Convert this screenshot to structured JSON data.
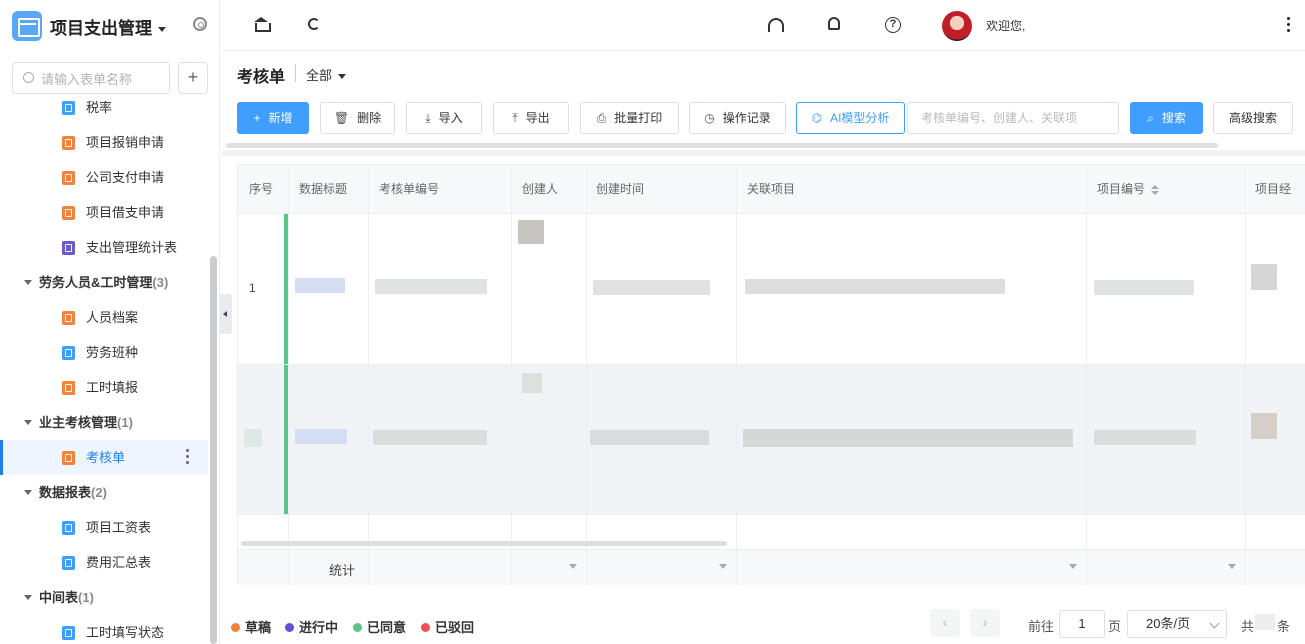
{
  "app": {
    "title": "项目支出管理"
  },
  "sidebar": {
    "search_placeholder": "请输入表单名称",
    "add_label": "+",
    "items": [
      {
        "label": "税率",
        "color": "#409eff"
      },
      {
        "label": "项目报销申请",
        "color": "#f4823c"
      },
      {
        "label": "公司支付申请",
        "color": "#f4823c"
      },
      {
        "label": "项目借支申请",
        "color": "#f4823c"
      },
      {
        "label": "支出管理统计表",
        "color": "#6a5acd"
      }
    ],
    "group_labor": {
      "label": "劳务人员&工时管理",
      "count": "(3)"
    },
    "labor_items": [
      {
        "label": "人员档案",
        "color": "#f4823c"
      },
      {
        "label": "劳务班种",
        "color": "#409eff"
      },
      {
        "label": "工时填报",
        "color": "#f4823c"
      }
    ],
    "group_owner": {
      "label": "业主考核管理",
      "count": "(1)"
    },
    "owner_items": [
      {
        "label": "考核单",
        "color": "#f4823c"
      }
    ],
    "group_report": {
      "label": "数据报表",
      "count": "(2)"
    },
    "report_items": [
      {
        "label": "项目工资表",
        "color": "#409eff"
      },
      {
        "label": "费用汇总表",
        "color": "#409eff"
      }
    ],
    "group_mid": {
      "label": "中间表",
      "count": "(1)"
    },
    "mid_items": [
      {
        "label": "工时填写状态",
        "color": "#409eff"
      }
    ]
  },
  "topbar": {
    "welcome": "欢迎您,",
    "help_glyph": "?"
  },
  "header": {
    "title": "考核单",
    "filter": "全部"
  },
  "toolbar": {
    "add": "新增",
    "add_icon": "+",
    "delete": "删除",
    "delete_icon": "🗑",
    "import": "导入",
    "import_icon": "⤓",
    "export": "导出",
    "export_icon": "⤒",
    "batch_print": "批量打印",
    "print_icon": "⎙",
    "op_log": "操作记录",
    "log_icon": "◷",
    "ai": "AI模型分析",
    "ai_icon": "⌬",
    "search_placeholder": "考核单编号、创建人、关联项",
    "search": "搜索",
    "search_icon": "⌕",
    "advanced": "高级搜索"
  },
  "table": {
    "columns": [
      "序号",
      "数据标题",
      "考核单编号",
      "创建人",
      "创建时间",
      "关联项目",
      "项目编号",
      "项目经"
    ],
    "rows": [
      {
        "index": "1"
      },
      {
        "index": ""
      }
    ],
    "footer_label": "统计"
  },
  "legend": [
    {
      "label": "草稿",
      "color": "#f4823c"
    },
    {
      "label": "进行中",
      "color": "#5b54d6"
    },
    {
      "label": "已同意",
      "color": "#5cc58a"
    },
    {
      "label": "已驳回",
      "color": "#f05050"
    }
  ],
  "pagination": {
    "prev": "‹",
    "next": "›",
    "goto_prefix": "前往",
    "page": "1",
    "goto_suffix": "页",
    "page_size": "20条/页",
    "total_prefix": "共",
    "total_suffix": "条"
  }
}
